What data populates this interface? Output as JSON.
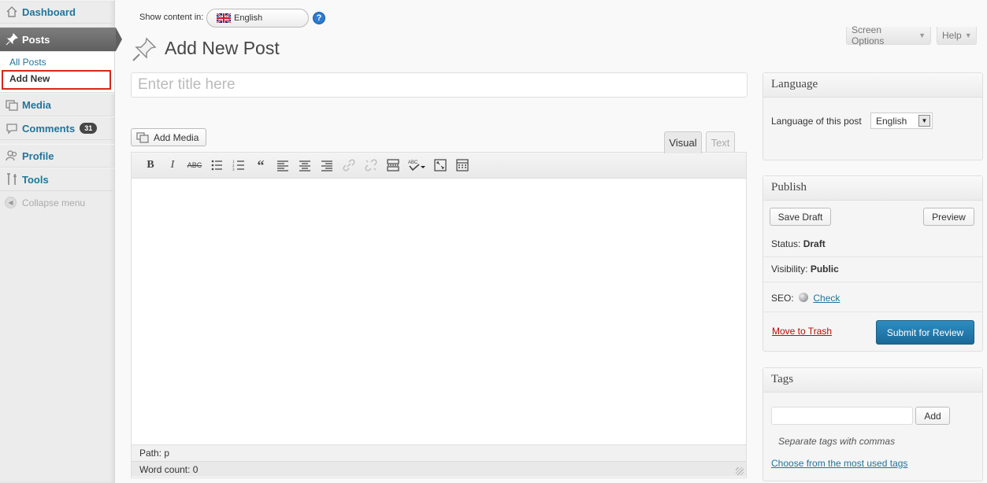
{
  "sidebar": {
    "items": [
      {
        "label": "Dashboard",
        "icon": "dashboard-icon"
      },
      {
        "label": "Posts",
        "icon": "pin-icon",
        "current": true
      },
      {
        "label": "Media",
        "icon": "media-icon"
      },
      {
        "label": "Comments",
        "icon": "comments-icon",
        "badge": "31"
      },
      {
        "label": "Profile",
        "icon": "profile-icon"
      },
      {
        "label": "Tools",
        "icon": "tools-icon"
      }
    ],
    "submenu": {
      "all_posts": "All Posts",
      "add_new": "Add New"
    },
    "collapse_label": "Collapse menu"
  },
  "topbar": {
    "show_content_label": "Show content in:",
    "language": "English",
    "help_icon": "help-icon",
    "screen_options": "Screen Options",
    "help": "Help"
  },
  "page": {
    "title": "Add New Post",
    "title_placeholder": "Enter title here"
  },
  "editor": {
    "add_media": "Add Media",
    "tabs": {
      "visual": "Visual",
      "text": "Text"
    },
    "toolbar_icons": [
      "bold-icon",
      "italic-icon",
      "strikethrough-icon",
      "bullet-list-icon",
      "numbered-list-icon",
      "blockquote-icon",
      "align-left-icon",
      "align-center-icon",
      "align-right-icon",
      "link-icon",
      "unlink-icon",
      "more-tag-icon",
      "spellcheck-icon",
      "fullscreen-icon",
      "kitchen-sink-icon"
    ],
    "path": "Path: p",
    "word_count": "Word count: 0"
  },
  "language_box": {
    "title": "Language",
    "label": "Language of this post",
    "selected": "English"
  },
  "publish_box": {
    "title": "Publish",
    "save_draft": "Save Draft",
    "preview": "Preview",
    "status_label": "Status:",
    "status_value": "Draft",
    "visibility_label": "Visibility:",
    "visibility_value": "Public",
    "seo_label": "SEO:",
    "seo_link": "Check",
    "trash": "Move to Trash",
    "submit": "Submit for Review"
  },
  "tags_box": {
    "title": "Tags",
    "add": "Add",
    "hint": "Separate tags with commas",
    "choose": "Choose from the most used tags"
  },
  "colors": {
    "link": "#21759b",
    "primary_button": "#2182b8",
    "trash": "#bc0b0b",
    "highlight_border": "#d9261c"
  }
}
